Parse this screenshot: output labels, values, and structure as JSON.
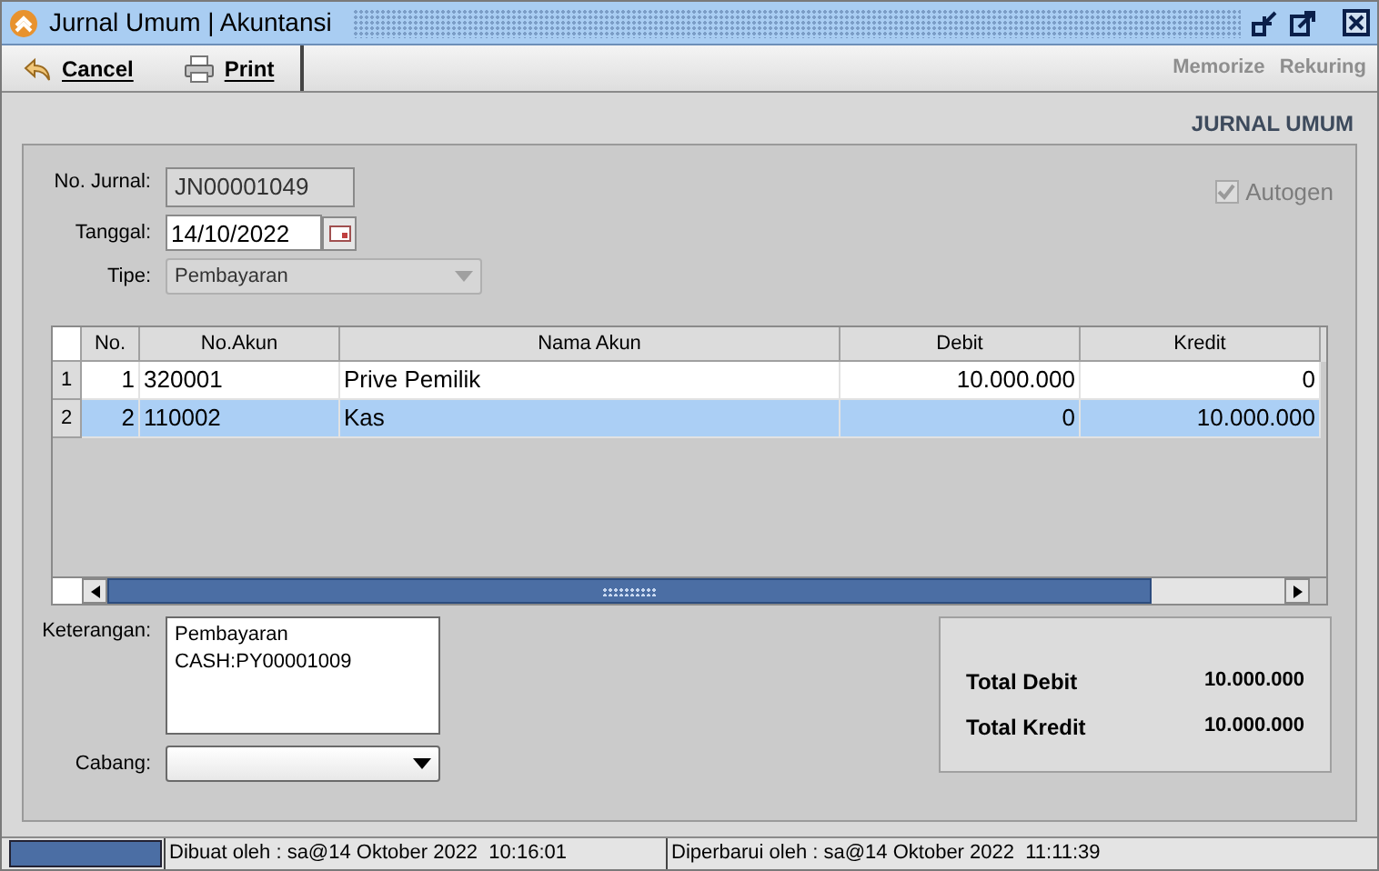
{
  "window": {
    "title": "Jurnal Umum | Akuntansi"
  },
  "toolbar": {
    "left": [
      {
        "label": "Cancel"
      },
      {
        "label": "Print"
      }
    ],
    "right": [
      {
        "label": "Memorize",
        "disabled": true
      },
      {
        "label": "Rekuring",
        "disabled": true
      }
    ]
  },
  "heading": "JURNAL UMUM",
  "form": {
    "no_jurnal": {
      "label": "No. Jurnal:",
      "value": "JN00001049"
    },
    "tanggal": {
      "label": "Tanggal:",
      "value": "14/10/2022"
    },
    "tipe": {
      "label": "Tipe:",
      "value": "Pembayaran",
      "disabled": true
    },
    "autogen": {
      "label": "Autogen",
      "checked": true,
      "disabled": true
    }
  },
  "table": {
    "columns": [
      "No.",
      "No.Akun",
      "Nama Akun",
      "Debit",
      "Kredit"
    ],
    "rows": [
      {
        "row_header": "1",
        "cells": [
          "1",
          "320001",
          "Prive Pemilik",
          "10.000.000",
          "0"
        ],
        "selected": false
      },
      {
        "row_header": "2",
        "cells": [
          "2",
          "110002",
          "Kas",
          "0",
          "10.000.000"
        ],
        "selected": true
      }
    ]
  },
  "keterangan": {
    "label": "Keterangan:",
    "lines": [
      "Pembayaran",
      "CASH:PY00001009"
    ]
  },
  "cabang": {
    "label": "Cabang:"
  },
  "totals": [
    {
      "label": "Total Debit",
      "value": "10.000.000"
    },
    {
      "label": "Total Kredit",
      "value": "10.000.000"
    }
  ],
  "status_bar": [
    "Dibuat oleh : sa@14 Oktober 2022  10:16:01",
    "Diperbarui oleh : sa@14 Oktober 2022  11:11:39"
  ]
}
